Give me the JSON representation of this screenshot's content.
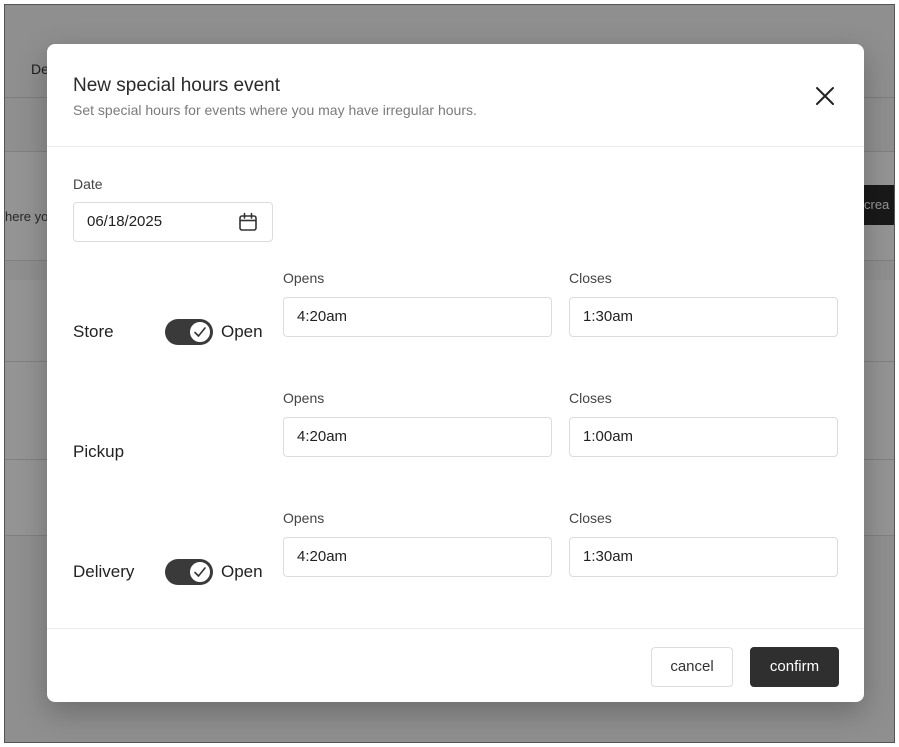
{
  "background": {
    "tab_partial": "De",
    "hint_partial": "here yo",
    "button_partial": "crea"
  },
  "modal": {
    "title": "New special hours event",
    "subtitle": "Set special hours for events where you may have irregular hours.",
    "close_icon": "close-icon",
    "date": {
      "label": "Date",
      "value": "06/18/2025",
      "icon": "calendar-icon"
    },
    "rows": [
      {
        "label": "Store",
        "toggle_on": true,
        "toggle_text": "Open",
        "opens_label": "Opens",
        "opens_value": "4:20am",
        "closes_label": "Closes",
        "closes_value": "1:30am"
      },
      {
        "label": "Pickup",
        "opens_label": "Opens",
        "opens_value": "4:20am",
        "closes_label": "Closes",
        "closes_value": "1:00am"
      },
      {
        "label": "Delivery",
        "toggle_on": true,
        "toggle_text": "Open",
        "opens_label": "Opens",
        "opens_value": "4:20am",
        "closes_label": "Closes",
        "closes_value": "1:30am"
      }
    ],
    "footer": {
      "cancel_label": "cancel",
      "confirm_label": "confirm"
    }
  },
  "colors": {
    "overlay": "#000000",
    "primary_button": "#2f2f2f",
    "toggle_on": "#3a3a3a"
  }
}
